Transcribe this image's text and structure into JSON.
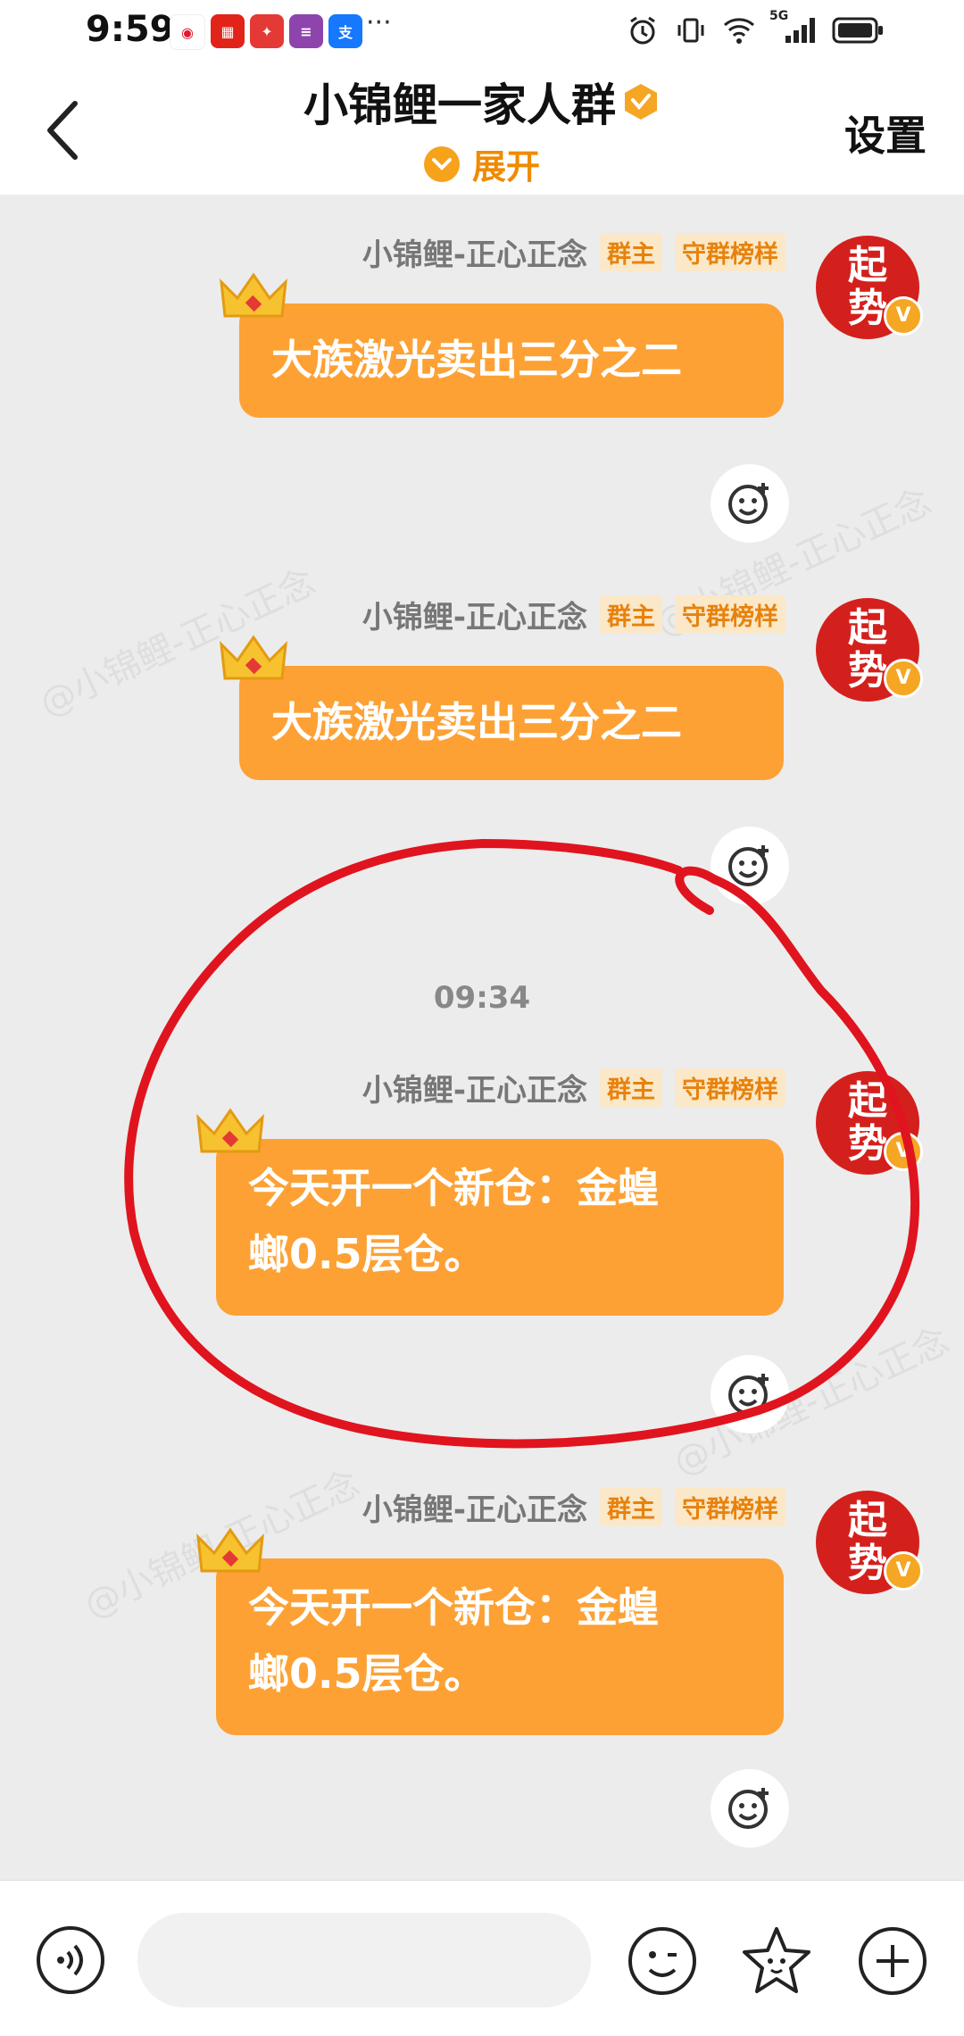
{
  "status_bar": {
    "time": "9:59",
    "app_icons": [
      "weibo-icon",
      "sina-news-icon",
      "app-red-icon",
      "shenmo-icon",
      "alipay-icon"
    ],
    "more": "···",
    "network": "5G"
  },
  "header": {
    "title": "小锦鲤一家人群",
    "expand_label": "展开",
    "settings_label": "设置"
  },
  "messages": [
    {
      "sender": "小锦鲤-正心正念",
      "badges": [
        "群主",
        "守群榜样"
      ],
      "text": "大族激光卖出三分之二",
      "avatar_text": [
        "起",
        "势"
      ]
    },
    {
      "sender": "小锦鲤-正心正念",
      "badges": [
        "群主",
        "守群榜样"
      ],
      "text": "大族激光卖出三分之二",
      "avatar_text": [
        "起",
        "势"
      ]
    },
    {
      "timestamp": "09:34",
      "sender": "小锦鲤-正心正念",
      "badges": [
        "群主",
        "守群榜样"
      ],
      "text_lines": [
        "今天开一个新仓：金蝗",
        "螂0.5层仓。"
      ],
      "avatar_text": [
        "起",
        "势"
      ]
    },
    {
      "sender": "小锦鲤-正心正念",
      "badges": [
        "群主",
        "守群榜样"
      ],
      "text_lines": [
        "今天开一个新仓：金蝗",
        "螂0.5层仓。"
      ],
      "avatar_text": [
        "起",
        "势"
      ]
    }
  ],
  "watermark": "@小锦鲤-正心正念",
  "input_bar": {
    "placeholder": "",
    "icons": [
      "voice-icon",
      "emoji-icon",
      "sticker-icon",
      "plus-icon"
    ]
  },
  "colors": {
    "bubble": "#fda134",
    "accent": "#f08a00",
    "annotation": "#e0141e"
  }
}
